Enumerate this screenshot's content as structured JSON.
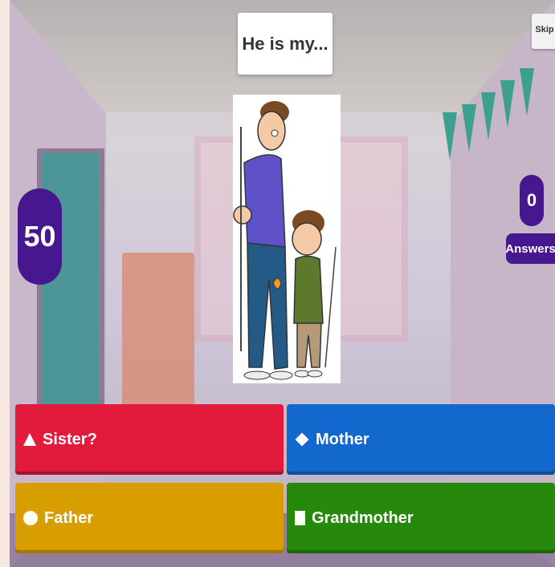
{
  "question": {
    "text": "He is my..."
  },
  "skip": {
    "label": "Skip"
  },
  "timer": {
    "value": "50"
  },
  "answers_counter": {
    "count": "0",
    "label": "Answers"
  },
  "answers": [
    {
      "label": "Sister?",
      "color": "#e21b3c",
      "shape": "triangle-icon"
    },
    {
      "label": "Mother",
      "color": "#1368ce",
      "shape": "diamond-icon"
    },
    {
      "label": "Father",
      "color": "#d89e00",
      "shape": "circle-icon"
    },
    {
      "label": "Grandmother",
      "color": "#26890c",
      "shape": "square-icon"
    }
  ],
  "colors": {
    "accent": "#46178f"
  }
}
